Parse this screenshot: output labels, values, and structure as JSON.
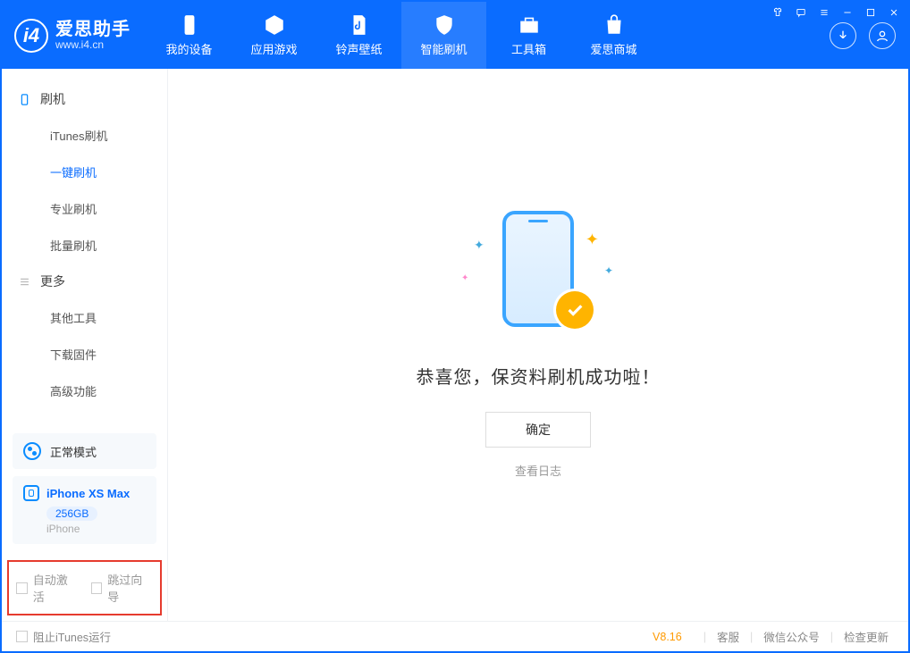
{
  "app": {
    "name_cn": "爱思助手",
    "name_en": "www.i4.cn"
  },
  "nav": {
    "tabs": [
      {
        "label": "我的设备"
      },
      {
        "label": "应用游戏"
      },
      {
        "label": "铃声壁纸"
      },
      {
        "label": "智能刷机"
      },
      {
        "label": "工具箱"
      },
      {
        "label": "爱思商城"
      }
    ]
  },
  "sidebar": {
    "group1": {
      "title": "刷机",
      "items": [
        {
          "label": "iTunes刷机"
        },
        {
          "label": "一键刷机"
        },
        {
          "label": "专业刷机"
        },
        {
          "label": "批量刷机"
        }
      ]
    },
    "group2": {
      "title": "更多",
      "items": [
        {
          "label": "其他工具"
        },
        {
          "label": "下载固件"
        },
        {
          "label": "高级功能"
        }
      ]
    },
    "mode": {
      "label": "正常模式"
    },
    "device": {
      "name": "iPhone XS Max",
      "capacity": "256GB",
      "type": "iPhone"
    },
    "options": {
      "auto_activate": "自动激活",
      "skip_guide": "跳过向导"
    }
  },
  "main": {
    "success_title": "恭喜您，保资料刷机成功啦！",
    "ok_button": "确定",
    "view_log": "查看日志"
  },
  "status": {
    "block_itunes": "阻止iTunes运行",
    "version": "V8.16",
    "links": {
      "support": "客服",
      "wechat": "微信公众号",
      "update": "检查更新"
    }
  }
}
